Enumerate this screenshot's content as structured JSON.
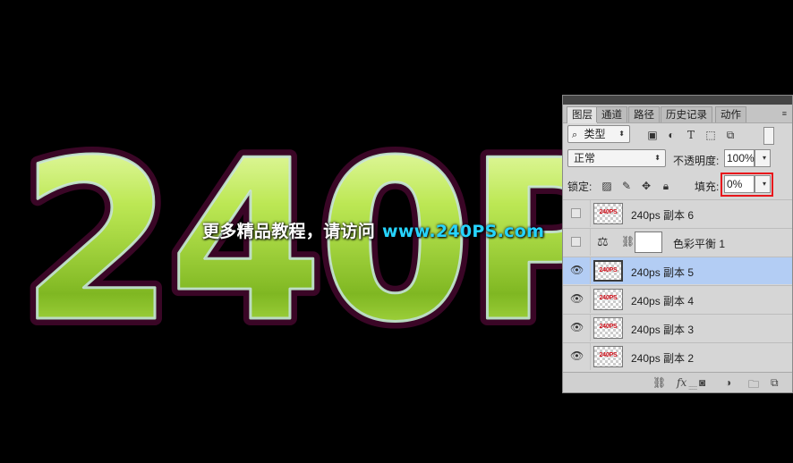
{
  "canvas": {
    "big_text": "240P",
    "watermark_cn": "更多精品教程，请访问",
    "watermark_url": "www.240PS.com"
  },
  "panel": {
    "tabs": [
      "图层",
      "通道",
      "路径",
      "历史记录",
      "动作"
    ],
    "filter_kind": "类型",
    "blend_mode": "正常",
    "opacity_label": "不透明度:",
    "opacity_value": "100%",
    "lock_label": "锁定:",
    "fill_label": "填充:",
    "fill_value": "0%",
    "layers": [
      {
        "name": "240ps 副本 6",
        "visible": false,
        "selected": false,
        "type": "pixel",
        "thumb_text": "240PS"
      },
      {
        "name": "色彩平衡 1",
        "visible": false,
        "selected": false,
        "type": "adjustment"
      },
      {
        "name": "240ps 副本 5",
        "visible": true,
        "selected": true,
        "type": "pixel",
        "thumb_text": "240PS"
      },
      {
        "name": "240ps 副本 4",
        "visible": true,
        "selected": false,
        "type": "pixel",
        "thumb_text": "240PS"
      },
      {
        "name": "240ps 副本 3",
        "visible": true,
        "selected": false,
        "type": "pixel",
        "thumb_text": "240PS"
      },
      {
        "name": "240ps 副本 2",
        "visible": true,
        "selected": false,
        "type": "pixel",
        "thumb_text": "240PS"
      }
    ],
    "bottom_icons": [
      "link-icon",
      "fx-icon",
      "add-mask-icon",
      "adjustment-icon",
      "group-folder-icon",
      "new-layer-icon"
    ],
    "selection_color": "#b3cdf4",
    "highlight_color": "#e8161b"
  }
}
